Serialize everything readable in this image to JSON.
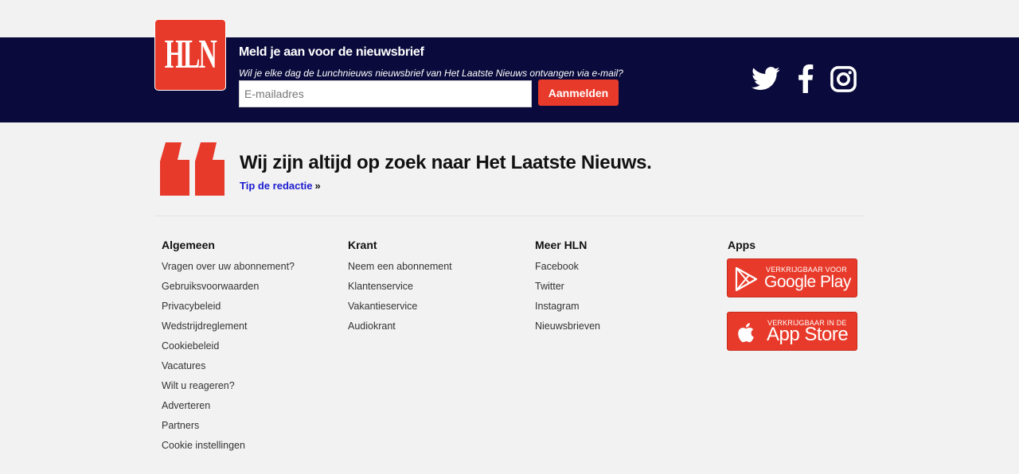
{
  "logo": {
    "text": "HLN"
  },
  "newsletter": {
    "title": "Meld je aan voor de nieuwsbrief",
    "subtitle": "Wil je elke dag de Lunchnieuws nieuwsbrief van Het Laatste Nieuws ontvangen via e-mail?",
    "email_placeholder": "E-mailadres",
    "email_value": "",
    "subscribe_label": "Aanmelden"
  },
  "social": [
    {
      "name": "twitter",
      "icon": "twitter-icon"
    },
    {
      "name": "facebook",
      "icon": "facebook-icon"
    },
    {
      "name": "instagram",
      "icon": "instagram-icon"
    }
  ],
  "quote": {
    "icon": "quote-icon",
    "text": "Wij zijn altijd op zoek naar Het Laatste Nieuws.",
    "link_label": "Tip de redactie",
    "link_chevron": "»"
  },
  "footer": {
    "columns": [
      {
        "heading": "Algemeen",
        "items": [
          "Vragen over uw abonnement?",
          "Gebruiksvoorwaarden",
          "Privacybeleid",
          "Wedstrijdreglement",
          "Cookiebeleid",
          "Vacatures",
          "Wilt u reageren?",
          "Adverteren",
          "Partners",
          "Cookie instellingen"
        ]
      },
      {
        "heading": "Krant",
        "items": [
          "Neem een abonnement",
          "Klantenservice",
          "Vakantieservice",
          "Audiokrant"
        ]
      },
      {
        "heading": "Meer HLN",
        "items": [
          "Facebook",
          "Twitter",
          "Instagram",
          "Nieuwsbrieven"
        ]
      }
    ],
    "apps": {
      "heading": "Apps",
      "google_play": {
        "small": "VERKRIJGBAAR VOOR",
        "big": "Google Play",
        "icon": "google-play-icon"
      },
      "app_store": {
        "small": "VERKRIJGBAAR IN DE",
        "big": "App Store",
        "icon": "apple-icon"
      }
    }
  },
  "colors": {
    "brand_red": "#e83a2a",
    "navy": "#0a0b3c",
    "link_blue": "#1a1ad0",
    "background": "#f2f2f2"
  }
}
